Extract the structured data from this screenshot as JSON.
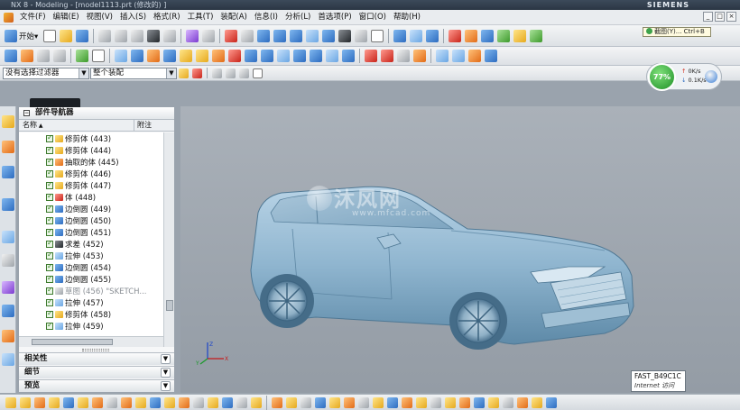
{
  "window": {
    "title": "NX 8 - Modeling - [model1113.prt (修改的) ]",
    "brand": "SIEMENS",
    "controls": [
      "_",
      "□",
      "×"
    ]
  },
  "menu": {
    "items": [
      "文件(F)",
      "编辑(E)",
      "视图(V)",
      "插入(S)",
      "格式(R)",
      "工具(T)",
      "装配(A)",
      "信息(I)",
      "分析(L)",
      "首选项(P)",
      "窗口(O)",
      "帮助(H)"
    ]
  },
  "toolbar": {
    "start_label": "开始▾",
    "filter_value": "没有选择过滤器",
    "assembly_scope_value": "整个装配"
  },
  "tooltip": {
    "text": "截图(Y)... Ctrl+B"
  },
  "netmeter": {
    "percent": "77%",
    "up": "0K/s",
    "down": "0.1K/s"
  },
  "navigator": {
    "title": "部件导航器",
    "columns": {
      "name": "名称",
      "note": "附注"
    },
    "rows": [
      {
        "label": "修剪体 (443)",
        "color": "yellow",
        "dim": false
      },
      {
        "label": "修剪体 (444)",
        "color": "yellow",
        "dim": false
      },
      {
        "label": "抽取的体 (445)",
        "color": "orange",
        "dim": false
      },
      {
        "label": "修剪体 (446)",
        "color": "yellow",
        "dim": false
      },
      {
        "label": "修剪体 (447)",
        "color": "yellow",
        "dim": false
      },
      {
        "label": "体 (448)",
        "color": "red",
        "dim": false
      },
      {
        "label": "边倒圆 (449)",
        "color": "blue",
        "dim": false
      },
      {
        "label": "边倒圆 (450)",
        "color": "blue",
        "dim": false
      },
      {
        "label": "边倒圆 (451)",
        "color": "blue",
        "dim": false
      },
      {
        "label": "求差 (452)",
        "color": "dark",
        "dim": false
      },
      {
        "label": "拉伸 (453)",
        "color": "lblue",
        "dim": false
      },
      {
        "label": "边倒圆 (454)",
        "color": "blue",
        "dim": false
      },
      {
        "label": "边倒圆 (455)",
        "color": "blue",
        "dim": false
      },
      {
        "label": "草图 (456) \"SKETCH...",
        "color": "gray",
        "dim": true
      },
      {
        "label": "拉伸 (457)",
        "color": "lblue",
        "dim": false
      },
      {
        "label": "修剪体 (458)",
        "color": "yellow",
        "dim": false
      },
      {
        "label": "拉伸 (459)",
        "color": "lblue",
        "dim": false
      }
    ],
    "sections": [
      "相关性",
      "细节",
      "预览"
    ]
  },
  "viewport": {
    "watermark": "沐风网",
    "watermark_url": "www.mfcad.com",
    "triad": {
      "x": "X",
      "y": "Y",
      "z": "Z"
    },
    "status_box": {
      "line1": "FAST_B49C1C",
      "line2": "Internet 访问"
    }
  }
}
